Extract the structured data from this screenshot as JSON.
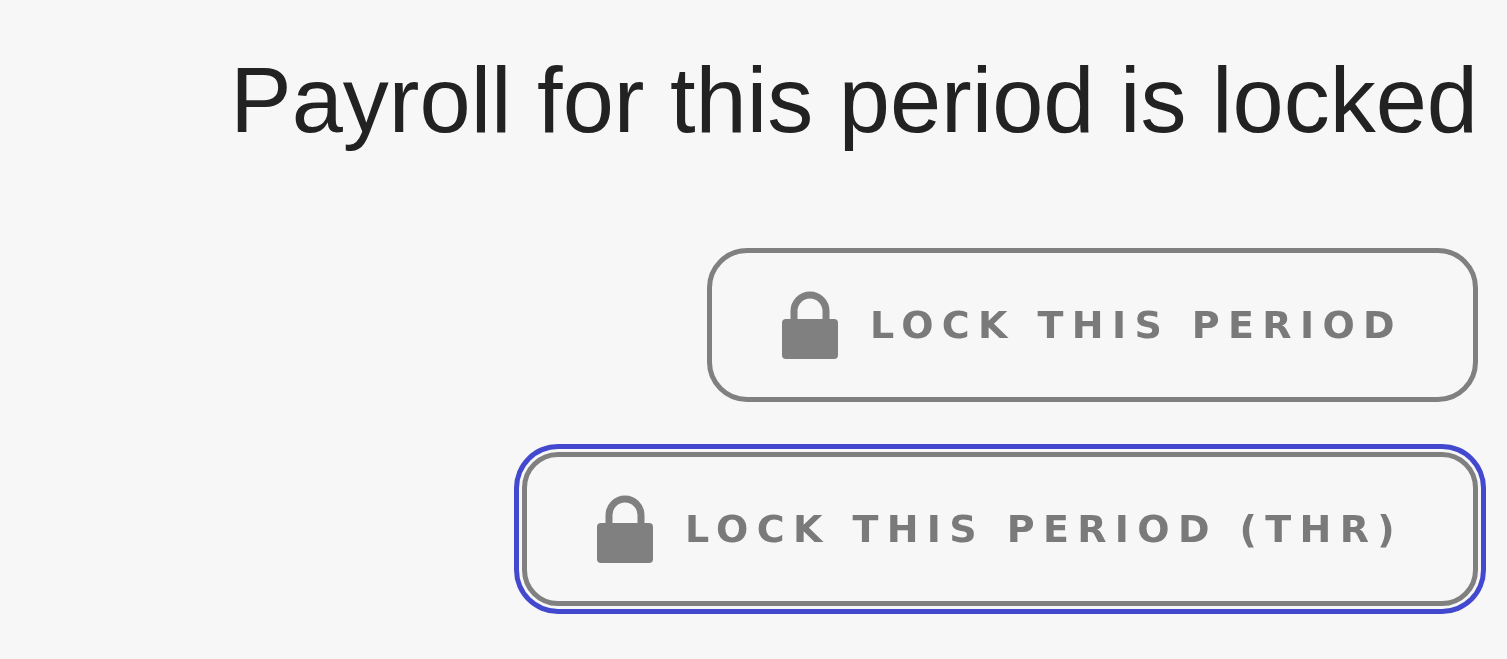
{
  "title": "Payroll for this period is locked",
  "buttons": [
    {
      "label": "LOCK THIS PERIOD",
      "focused": false
    },
    {
      "label": "LOCK THIS PERIOD (THR)",
      "focused": true
    }
  ]
}
